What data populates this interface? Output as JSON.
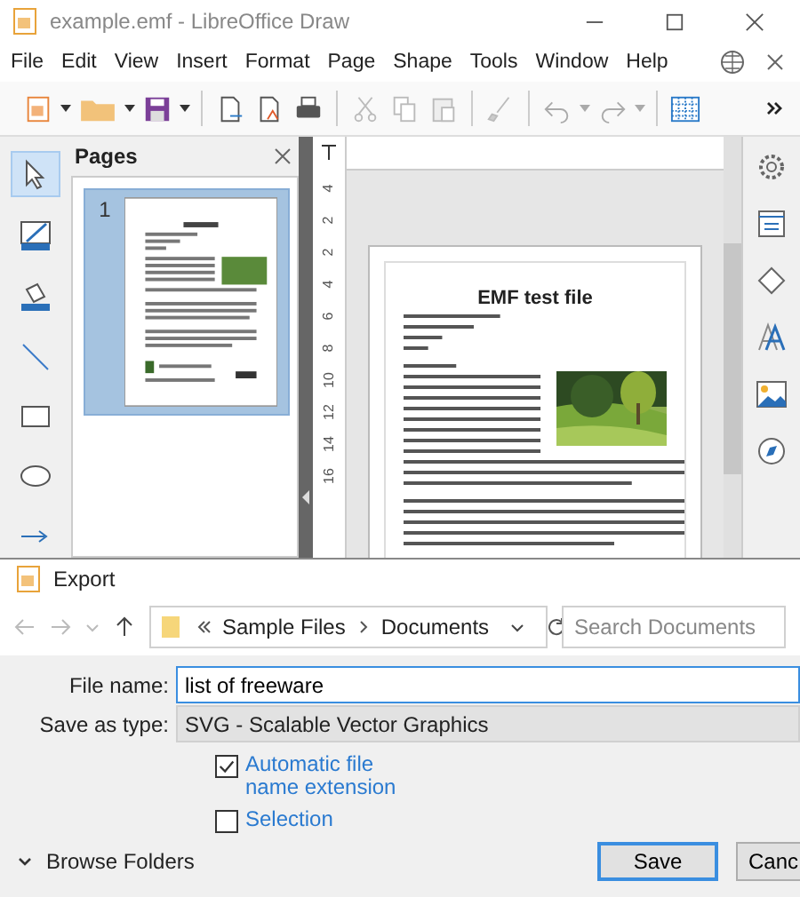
{
  "window": {
    "title": "example.emf - LibreOffice Draw"
  },
  "menu": [
    "File",
    "Edit",
    "View",
    "Insert",
    "Format",
    "Page",
    "Shape",
    "Tools",
    "Window",
    "Help"
  ],
  "tools": [
    {
      "kind": "select",
      "selected": true
    },
    {
      "kind": "line-color",
      "selected": false
    },
    {
      "kind": "fill-color",
      "selected": false
    },
    {
      "kind": "line",
      "selected": false
    },
    {
      "kind": "rectangle",
      "selected": false
    },
    {
      "kind": "ellipse",
      "selected": false
    },
    {
      "kind": "arrow",
      "selected": false
    }
  ],
  "pages_panel": {
    "title": "Pages",
    "pages": [
      {
        "number": "1",
        "selected": true
      }
    ]
  },
  "ruler": [
    "4",
    "2",
    "2",
    "4",
    "6",
    "8",
    "10",
    "12",
    "14",
    "16"
  ],
  "document": {
    "title": "EMF test file"
  },
  "export_dialog": {
    "title": "Export",
    "path": [
      "Sample Files",
      "Documents"
    ],
    "search": {
      "placeholder": "Search Documents"
    },
    "file_name": {
      "label": "File name:",
      "value": "list of freeware"
    },
    "save_type": {
      "label": "Save as type:",
      "value": "SVG - Scalable Vector Graphics"
    },
    "options": [
      {
        "label": "Automatic file name extension",
        "checked": true
      },
      {
        "label": "Selection",
        "checked": false
      }
    ],
    "browse": "Browse Folders",
    "buttons": [
      "Save",
      "Canc"
    ]
  }
}
